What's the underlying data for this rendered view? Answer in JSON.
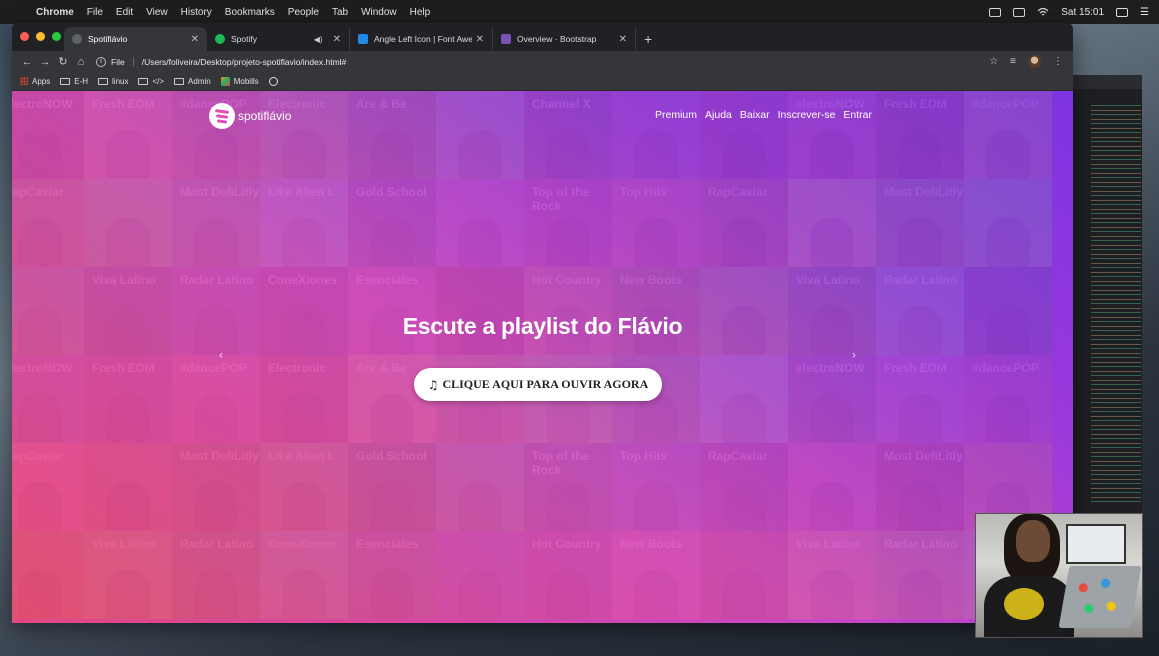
{
  "menubar": {
    "app": "Chrome",
    "items": [
      "File",
      "Edit",
      "View",
      "History",
      "Bookmarks",
      "People",
      "Tab",
      "Window",
      "Help"
    ],
    "clock": "Sat 15:01"
  },
  "tabs": [
    {
      "title": "Spotifiávio",
      "active": true
    },
    {
      "title": "Spotify",
      "active": false
    },
    {
      "title": "Angle Left Icon | Font Awesome",
      "active": false
    },
    {
      "title": "Overview · Bootstrap",
      "active": false
    }
  ],
  "omnibox": {
    "scheme_label": "File",
    "url": "/Users/foliveira/Desktop/projeto-spotiflavio/index.html#"
  },
  "bookmarks": [
    "Apps",
    "E-H",
    "linux",
    "</>",
    "Admin",
    "Mobills"
  ],
  "site": {
    "brand": "spotiflávio",
    "nav": [
      "Premium",
      "Ajuda",
      "Baixar",
      "Inscrever-se",
      "Entrar"
    ],
    "hero_title": "Escute a playlist do Flávio",
    "cta_label": "CLIQUE AQUI PARA OUVIR AGORA",
    "prev_arrow": "‹",
    "next_arrow": "›"
  },
  "mosaic": [
    "electroNOW",
    "Fresh EDM",
    "#dancePOP",
    "Electronic",
    "Are & Be",
    "",
    "Channel X",
    "",
    "",
    "electroNOW",
    "Fresh EDM",
    "#dancePOP",
    "RapCaviar",
    "",
    "Most DefiLitly",
    "Like Allen I.",
    "Gold School",
    "",
    "Top of the Rock",
    "Top Hits",
    "RapCaviar",
    "",
    "Most DefiLitly",
    "",
    "",
    "Viva Latino",
    "Radar Latino",
    "ConeXiones",
    "Esenciales",
    "",
    "Hot Country",
    "New Boots",
    "",
    "Viva Latino",
    "Radar Latino",
    "",
    "electroNOW",
    "Fresh EDM",
    "#dancePOP",
    "Electronic",
    "Are & Be",
    "",
    "",
    "",
    "",
    "electroNOW",
    "Fresh EDM",
    "#dancePOP",
    "RapCaviar",
    "",
    "Most DefiLitly",
    "Like Allen I.",
    "Gold School",
    "",
    "Top of the Rock",
    "Top Hits",
    "RapCaviar",
    "",
    "Most DefiLitly",
    "",
    "",
    "Viva Latino",
    "Radar Latino",
    "ConeXiones",
    "Esenciales",
    "",
    "Hot Country",
    "New Boots",
    "",
    "Viva Latino",
    "Radar Latino",
    ""
  ],
  "colors": {
    "gradient_start": "#f44b78",
    "gradient_end": "#7e34e8",
    "cta_bg": "#ffffff"
  }
}
